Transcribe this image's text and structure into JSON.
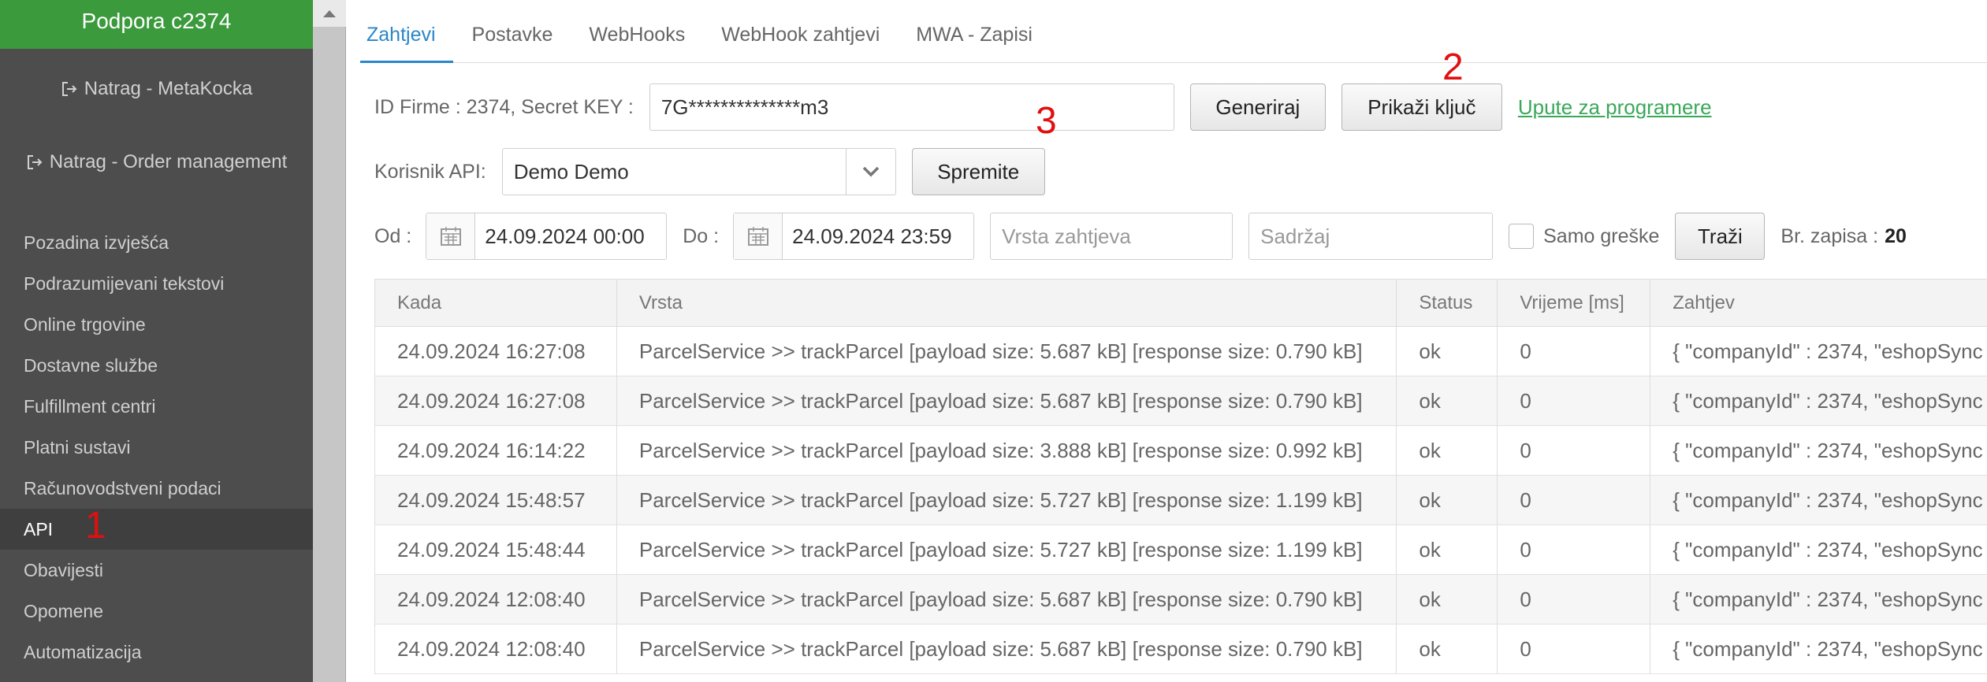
{
  "sidebar": {
    "title": "Podpora c2374",
    "back_links": [
      "Natrag - MetaKocka",
      "Natrag - Order management"
    ],
    "items": [
      {
        "label": "Pozadina izvješća"
      },
      {
        "label": "Podrazumijevani tekstovi"
      },
      {
        "label": "Online trgovine"
      },
      {
        "label": "Dostavne službe"
      },
      {
        "label": "Fulfillment centri"
      },
      {
        "label": "Platni sustavi"
      },
      {
        "label": "Računovodstveni podaci"
      },
      {
        "label": "API"
      },
      {
        "label": "Obavijesti"
      },
      {
        "label": "Opomene"
      },
      {
        "label": "Automatizacija"
      }
    ],
    "active_index": 7
  },
  "annotations": [
    "1",
    "2",
    "3"
  ],
  "tabs": [
    {
      "label": "Zahtjevi"
    },
    {
      "label": "Postavke"
    },
    {
      "label": "WebHooks"
    },
    {
      "label": "WebHook zahtjevi"
    },
    {
      "label": "MWA - Zapisi"
    }
  ],
  "key_row": {
    "label": "ID Firme : 2374, Secret KEY :",
    "value": "7G**************m3",
    "generate_label": "Generiraj",
    "show_key_label": "Prikaži ključ",
    "dev_link": "Upute za programere"
  },
  "api_user": {
    "label": "Korisnik API:",
    "selected": "Demo Demo",
    "save_label": "Spremite"
  },
  "filters": {
    "from_label": "Od :",
    "from_value": "24.09.2024 00:00",
    "to_label": "Do :",
    "to_value": "24.09.2024 23:59",
    "type_placeholder": "Vrsta zahtjeva",
    "content_placeholder": "Sadržaj",
    "errors_only_label": "Samo greške",
    "search_label": "Traži",
    "count_label": "Br. zapisa :",
    "count_value": "20"
  },
  "table": {
    "headers": [
      "Kada",
      "Vrsta",
      "Status",
      "Vrijeme [ms]",
      "Zahtjev"
    ],
    "rows": [
      [
        "24.09.2024 16:27:08",
        "ParcelService >> trackParcel [payload size: 5.687 kB] [response size: 0.790 kB]",
        "ok",
        "0",
        "{ \"companyId\" : 2374, \"eshopSync"
      ],
      [
        "24.09.2024 16:27:08",
        "ParcelService >> trackParcel [payload size: 5.687 kB] [response size: 0.790 kB]",
        "ok",
        "0",
        "{ \"companyId\" : 2374, \"eshopSync"
      ],
      [
        "24.09.2024 16:14:22",
        "ParcelService >> trackParcel [payload size: 3.888 kB] [response size: 0.992 kB]",
        "ok",
        "0",
        "{ \"companyId\" : 2374, \"eshopSync"
      ],
      [
        "24.09.2024 15:48:57",
        "ParcelService >> trackParcel [payload size: 5.727 kB] [response size: 1.199 kB]",
        "ok",
        "0",
        "{ \"companyId\" : 2374, \"eshopSync"
      ],
      [
        "24.09.2024 15:48:44",
        "ParcelService >> trackParcel [payload size: 5.727 kB] [response size: 1.199 kB]",
        "ok",
        "0",
        "{ \"companyId\" : 2374, \"eshopSync"
      ],
      [
        "24.09.2024 12:08:40",
        "ParcelService >> trackParcel [payload size: 5.687 kB] [response size: 0.790 kB]",
        "ok",
        "0",
        "{ \"companyId\" : 2374, \"eshopSync"
      ],
      [
        "24.09.2024 12:08:40",
        "ParcelService >> trackParcel [payload size: 5.687 kB] [response size: 0.790 kB]",
        "ok",
        "0",
        "{ \"companyId\" : 2374, \"eshopSync"
      ]
    ]
  }
}
